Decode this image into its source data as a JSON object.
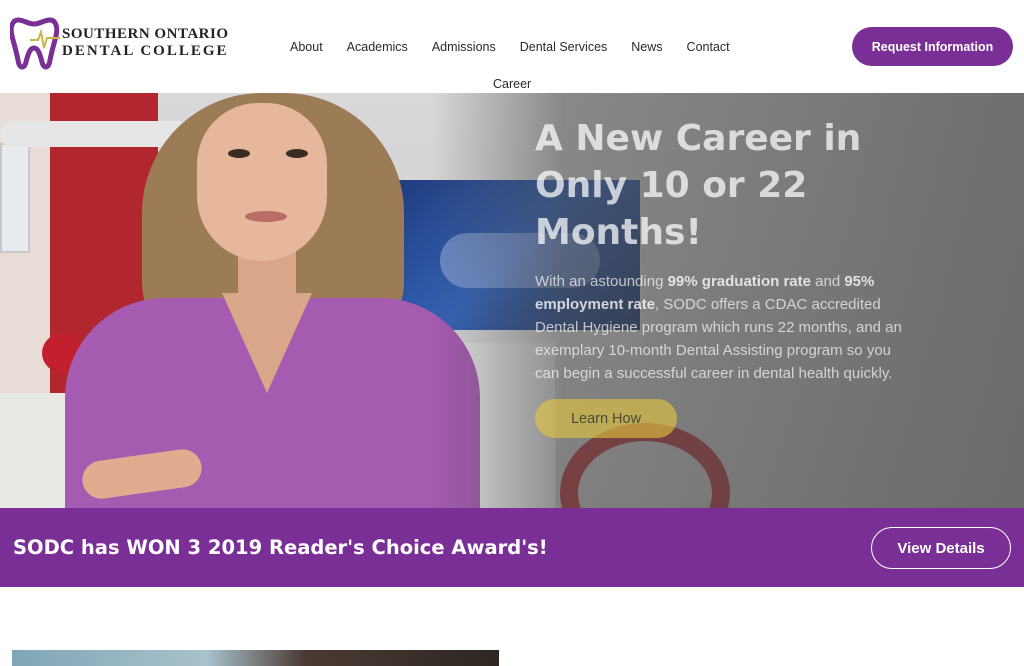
{
  "header": {
    "logo_line1": "SOUTHERN ONTARIO",
    "logo_line2": "DENTAL COLLEGE",
    "logo_colors": {
      "tooth": "#7a2f97",
      "pulse": "#c7b64a"
    },
    "nav": [
      "About",
      "Academics",
      "Admissions",
      "Dental Services",
      "News",
      "Contact"
    ],
    "nav_career": "Career",
    "cta_label": "Request Information"
  },
  "hero": {
    "title": "A New Career in Only 10 or 22 Months!",
    "text_parts": {
      "p1": "With an astounding ",
      "b1": "99% graduation rate",
      "p2": " and ",
      "b2": "95% employment rate",
      "p3": ", SODC offers a CDAC accredited Dental Hygiene program which runs 22 months, and an exemplary 10-month Dental Assisting program so you can begin a successful career in dental health quickly."
    },
    "button_label": "Learn How"
  },
  "award": {
    "text": "SODC has WON 3 2019 Reader's Choice Award's!",
    "button_label": "View Details"
  },
  "colors": {
    "brand_purple": "#7a2f97",
    "learn_button": "#e6c83c"
  }
}
